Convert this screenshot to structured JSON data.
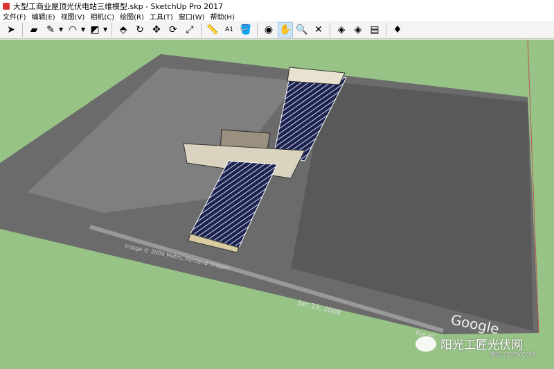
{
  "window": {
    "title": "大型工商业屋顶光伏电站三维模型.skp - SketchUp Pro 2017"
  },
  "menu": [
    "文件(F)",
    "编辑(E)",
    "视图(V)",
    "相机(C)",
    "绘图(R)",
    "工具(T)",
    "窗口(W)",
    "帮助(H)"
  ],
  "toolbar": {
    "tools": [
      {
        "name": "select",
        "glyph": "➤"
      },
      {
        "name": "eraser",
        "glyph": "▰"
      },
      {
        "name": "pencil",
        "glyph": "✎",
        "dd": true
      },
      {
        "name": "arc",
        "glyph": "◠",
        "dd": true
      },
      {
        "name": "rectangle",
        "glyph": "◩",
        "dd": true
      },
      {
        "name": "push-pull",
        "glyph": "⬘"
      },
      {
        "name": "offset",
        "glyph": "↻"
      },
      {
        "name": "move",
        "glyph": "✥"
      },
      {
        "name": "rotate",
        "glyph": "⟳"
      },
      {
        "name": "scale",
        "glyph": "⤢"
      },
      {
        "name": "tape-measure",
        "glyph": "📏"
      },
      {
        "name": "text",
        "glyph": "A1"
      },
      {
        "name": "paint-bucket",
        "glyph": "🪣"
      },
      {
        "name": "orbit",
        "glyph": "◉"
      },
      {
        "name": "pan",
        "glyph": "✋",
        "active": true
      },
      {
        "name": "zoom",
        "glyph": "🔍"
      },
      {
        "name": "zoom-extents",
        "glyph": "✕"
      },
      {
        "name": "3d-warehouse",
        "glyph": "◈"
      },
      {
        "name": "extension-warehouse",
        "glyph": "◈"
      },
      {
        "name": "send-to-layout",
        "glyph": "▤"
      },
      {
        "name": "ruby-console",
        "glyph": "♦"
      }
    ]
  },
  "scene": {
    "labels": {
      "copyright": "Image © 2009 Metro, Portland Oregon",
      "date": "Jun 19, 2008",
      "google": "Google",
      "eye": "Eye alt"
    }
  },
  "watermark": {
    "text": "阳光工匠光伏网",
    "sub": "BBS.21SPV.COM"
  },
  "colors": {
    "ground": "#97c387",
    "accent": "#d33"
  }
}
